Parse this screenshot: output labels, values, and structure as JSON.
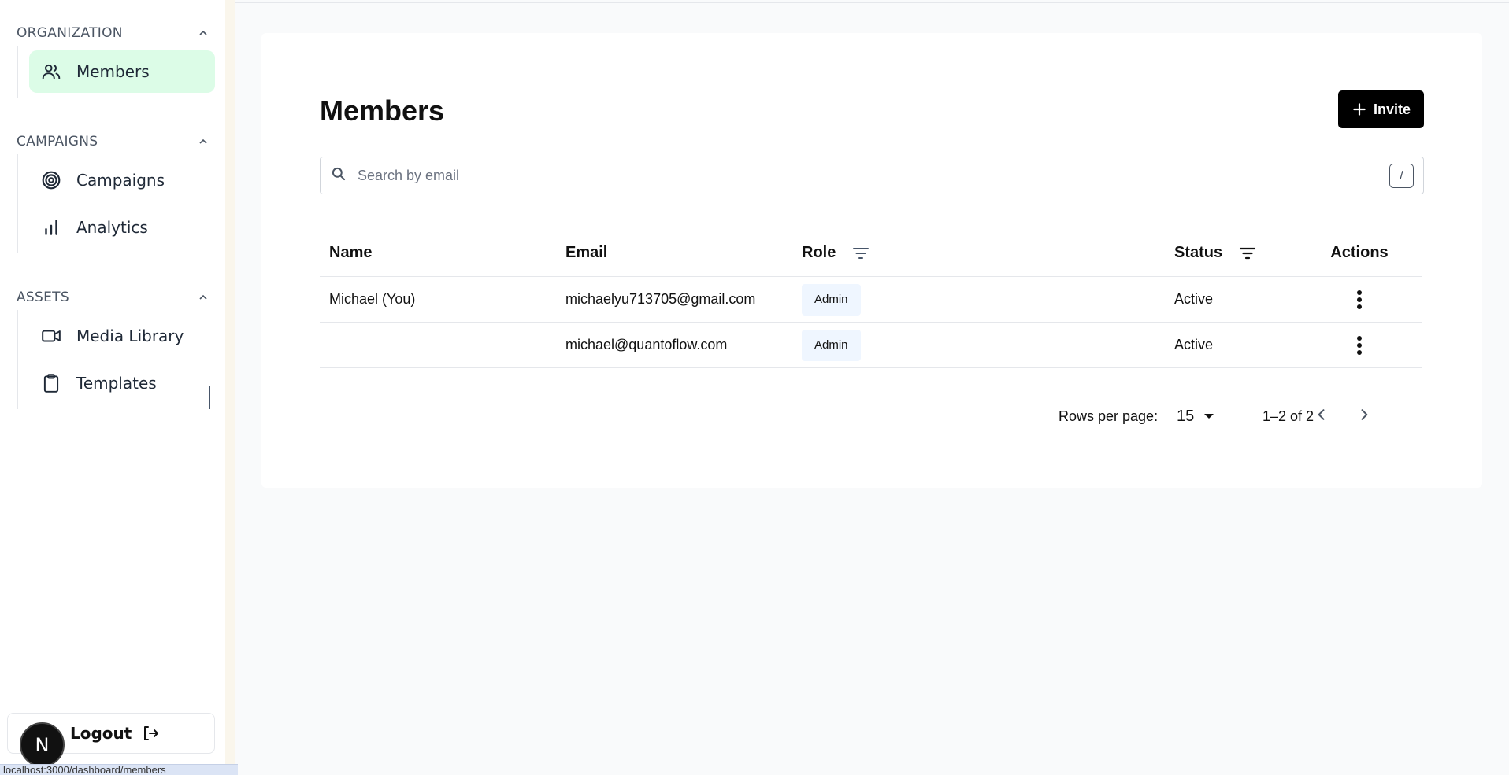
{
  "sidebar": {
    "sections": [
      {
        "title": "ORGANIZATION",
        "items": [
          {
            "label": "Members",
            "icon": "users-icon",
            "active": true
          }
        ]
      },
      {
        "title": "CAMPAIGNS",
        "items": [
          {
            "label": "Campaigns",
            "icon": "target-icon"
          },
          {
            "label": "Analytics",
            "icon": "bar-chart-icon"
          }
        ]
      },
      {
        "title": "ASSETS",
        "items": [
          {
            "label": "Media Library",
            "icon": "video-icon"
          },
          {
            "label": "Templates",
            "icon": "clipboard-icon"
          }
        ]
      }
    ],
    "logout_label": "Logout",
    "avatar_letter": "N"
  },
  "status_bar": {
    "text": "localhost:3000/dashboard/members"
  },
  "main": {
    "title": "Members",
    "invite_label": "Invite",
    "search": {
      "placeholder": "Search by email",
      "value": "",
      "shortcut": "/"
    },
    "table": {
      "columns": {
        "name": "Name",
        "email": "Email",
        "role": "Role",
        "status": "Status",
        "actions": "Actions"
      },
      "rows": [
        {
          "name": "Michael (You)",
          "email": "michaelyu713705@gmail.com",
          "role": "Admin",
          "status": "Active"
        },
        {
          "name": "",
          "email": "michael@quantoflow.com",
          "role": "Admin",
          "status": "Active"
        }
      ]
    },
    "pagination": {
      "rows_per_page_label": "Rows per page:",
      "rows_per_page": "15",
      "range": "1–2 of 2"
    }
  },
  "colors": {
    "active_nav_bg": "#dcfce7",
    "primary_button": "#000000",
    "role_badge_bg": "#eff6ff"
  }
}
